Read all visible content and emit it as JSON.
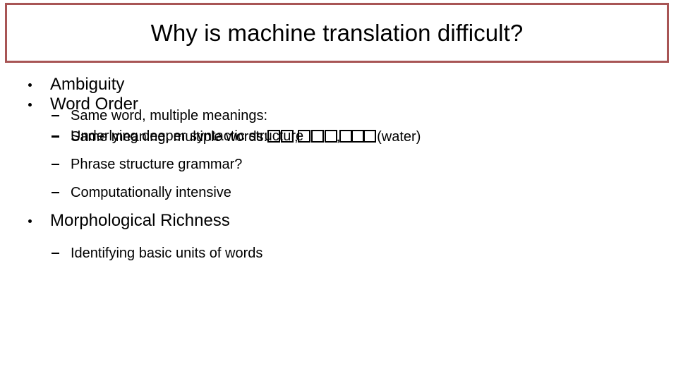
{
  "slide": {
    "title": "Why is machine translation difficult?",
    "title_border_color": "#a85555",
    "background_color": "#ffffff",
    "text_color": "#000000"
  },
  "bullets": [
    {
      "label": "Ambiguity",
      "sub": [
        {
          "text": "Same word, multiple meanings:"
        },
        {
          "prefix": "Same meaning, multiple words:",
          "glyphs": "□□,□□□,□□□",
          "gloss": "(water)",
          "note": "unrenderable CJK characters shown as missing-glyph boxes"
        }
      ]
    },
    {
      "label": "Word Order",
      "sub": [
        {
          "text": "Underlying deeper syntactic structure"
        },
        {
          "text": "Phrase structure grammar?"
        },
        {
          "text": "Computationally intensive"
        }
      ]
    },
    {
      "label": "Morphological Richness",
      "sub": [
        {
          "text": "Identifying basic units of words"
        }
      ]
    }
  ]
}
